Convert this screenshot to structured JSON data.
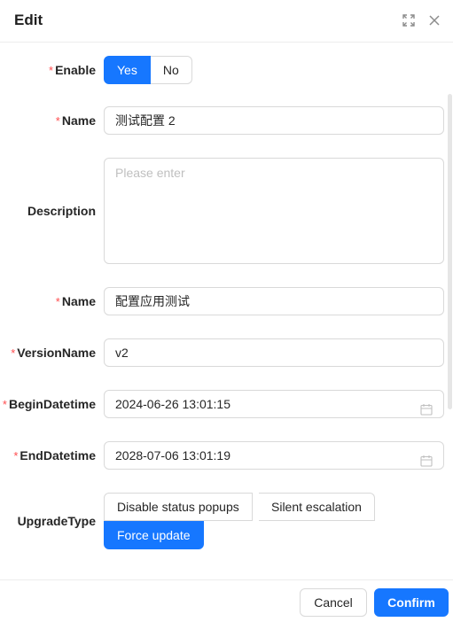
{
  "dialog": {
    "title": "Edit",
    "expand_icon": "expand-icon",
    "close_icon": "close-icon"
  },
  "form": {
    "enable": {
      "label": "Enable",
      "required": "*",
      "options": [
        "Yes",
        "No"
      ],
      "selected": "Yes"
    },
    "name": {
      "label": "Name",
      "required": "*",
      "value": "测试配置 2"
    },
    "description": {
      "label": "Description",
      "placeholder": "Please enter",
      "value": ""
    },
    "app_name": {
      "label": "Name",
      "required": "*",
      "value": "配置应用测试"
    },
    "version_name": {
      "label": "VersionName",
      "required": "*",
      "value": "v2"
    },
    "begin_datetime": {
      "label": "BeginDatetime",
      "required": "*",
      "value": "2024-06-26 13:01:15",
      "icon": "calendar-icon"
    },
    "end_datetime": {
      "label": "EndDatetime",
      "required": "*",
      "value": "2028-07-06 13:01:19",
      "icon": "calendar-icon"
    },
    "upgrade_type": {
      "label": "UpgradeType",
      "options": [
        "Disable status popups",
        "Silent escalation",
        "Force update"
      ],
      "selected": "Force update"
    }
  },
  "footer": {
    "cancel_label": "Cancel",
    "confirm_label": "Confirm"
  },
  "colors": {
    "primary": "#1677ff",
    "required": "#ff4d4f",
    "border": "#d9d9d9"
  }
}
